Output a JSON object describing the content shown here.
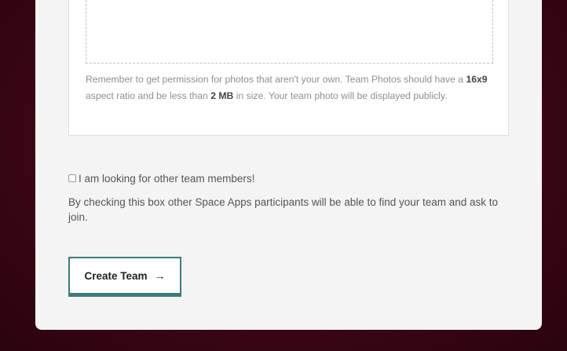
{
  "photo_note": {
    "part1": "Remember to get permission for photos that aren't your own. Team Photos should have a ",
    "ratio": "16x9",
    "part2": " aspect ratio and be less than ",
    "size": "2 MB",
    "part3": " in size. Your team photo will be displayed publicly."
  },
  "looking_checkbox": {
    "label": "I am looking for other team members!",
    "checked": false
  },
  "helper_text": "By checking this box other Space Apps participants will be able to find your team and ask to join.",
  "create_button": {
    "label": "Create Team",
    "arrow": "→"
  },
  "colors": {
    "background": "#3e0616",
    "button_accent": "#3e7a7a"
  }
}
